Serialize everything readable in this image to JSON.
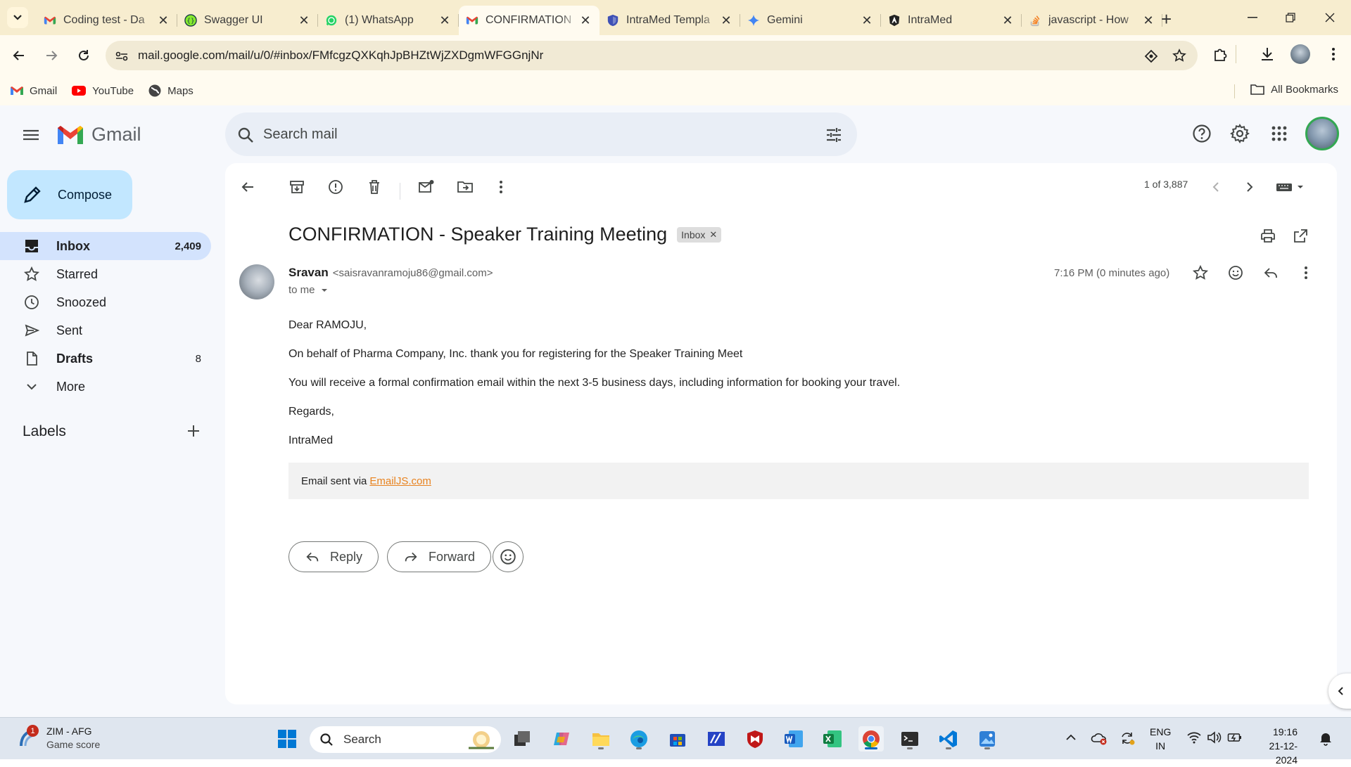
{
  "browser": {
    "tabs": [
      {
        "label": "Coding test - Da",
        "icon": "gmail-icon",
        "active": false
      },
      {
        "label": "Swagger UI",
        "icon": "swagger-icon",
        "active": false
      },
      {
        "label": "(1) WhatsApp",
        "icon": "whatsapp-icon",
        "active": false
      },
      {
        "label": "CONFIRMATION",
        "icon": "gmail-icon",
        "active": true
      },
      {
        "label": "IntraMed Templa",
        "icon": "intramed-shield-icon",
        "active": false
      },
      {
        "label": "Gemini",
        "icon": "gemini-icon",
        "active": false
      },
      {
        "label": "IntraMed",
        "icon": "angular-icon",
        "active": false
      },
      {
        "label": "javascript - How",
        "icon": "stackoverflow-icon",
        "active": false
      }
    ],
    "url": "mail.google.com/mail/u/0/#inbox/FMfcgzQXKqhJpBHZtWjZXDgmWFGGnjNr",
    "bookmarks": [
      {
        "label": "Gmail",
        "icon": "gmail-icon"
      },
      {
        "label": "YouTube",
        "icon": "youtube-icon"
      },
      {
        "label": "Maps",
        "icon": "maps-icon"
      }
    ],
    "all_bookmarks": "All Bookmarks"
  },
  "gmail": {
    "logo_text": "Gmail",
    "search_placeholder": "Search mail",
    "compose": "Compose",
    "nav": [
      {
        "label": "Inbox",
        "count": "2,409",
        "icon": "inbox-icon"
      },
      {
        "label": "Starred",
        "count": "",
        "icon": "star-icon"
      },
      {
        "label": "Snoozed",
        "count": "",
        "icon": "clock-icon"
      },
      {
        "label": "Sent",
        "count": "",
        "icon": "send-icon"
      },
      {
        "label": "Drafts",
        "count": "8",
        "icon": "draft-icon"
      },
      {
        "label": "More",
        "count": "",
        "icon": "chevron-down-icon"
      }
    ],
    "labels_heading": "Labels",
    "pager": "1 of 3,887",
    "message": {
      "subject": "CONFIRMATION - Speaker Training Meeting",
      "label_chip": "Inbox",
      "sender_name": "Sravan",
      "sender_email": "<saisravanramoju86@gmail.com>",
      "recipient": "to me",
      "time": "7:16 PM (0 minutes ago)",
      "body": [
        "Dear RAMOJU,",
        "On behalf of Pharma Company, Inc. thank you for registering for the Speaker Training Meet",
        "You will receive a formal confirmation email within the next 3-5 business days, including information for booking your travel.",
        "Regards,",
        "IntraMed"
      ],
      "footer_prefix": "Email sent via",
      "footer_link": "EmailJS.com"
    },
    "reply": "Reply",
    "forward": "Forward"
  },
  "taskbar": {
    "weather_title": "ZIM - AFG",
    "weather_sub": "Game score",
    "weather_badge": "1",
    "search": "Search",
    "lang_1": "ENG",
    "lang_2": "IN",
    "time": "19:16",
    "date": "21-12-2024"
  },
  "colors": {
    "tabstrip": "#f7edcf",
    "toolbar": "#fffbf0",
    "gmail_bg": "#f6f8fc",
    "compose": "#c2e7ff",
    "active_nav": "#d3e3fd",
    "link": "#e8821e"
  }
}
